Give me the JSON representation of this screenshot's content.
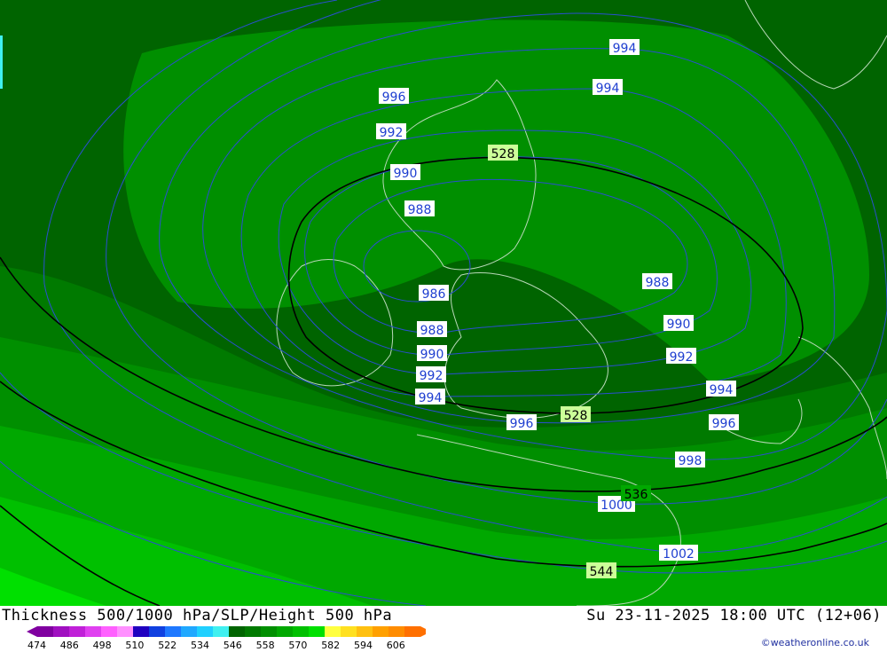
{
  "header": {
    "title": "Thickness 500/1000 hPa/SLP/Height 500 hPa",
    "datetime": "Su 23-11-2025 18:00 UTC (12+06)"
  },
  "credit": "©weatheronline.co.uk",
  "legend": {
    "labels": [
      "474",
      "486",
      "498",
      "510",
      "522",
      "534",
      "546",
      "558",
      "570",
      "582",
      "594",
      "606"
    ],
    "colors": [
      "#8000a0",
      "#a010c0",
      "#c020d8",
      "#e040f0",
      "#ff60ff",
      "#ff90ff",
      "#2000c0",
      "#1040e0",
      "#1e78ff",
      "#20a8ff",
      "#20d0ff",
      "#40f0f0",
      "#006400",
      "#007a00",
      "#008f00",
      "#00a800",
      "#00c000",
      "#00e000",
      "#ffff40",
      "#ffe020",
      "#ffc010",
      "#ffa000",
      "#ff8c00",
      "#ff7000"
    ]
  },
  "map": {
    "colors": {
      "band_dark": "#006400",
      "band_mid": "#007a00",
      "band_main": "#008f00",
      "band_light": "#00a800",
      "band_lighter": "#00c000",
      "band_lightest": "#00e000",
      "isobar": "#2a4fd0",
      "coastline": "#b8d8b8",
      "contour_500": "#000000"
    },
    "isobar_labels": [
      "994",
      "996",
      "994",
      "992",
      "990",
      "988",
      "986",
      "988",
      "990",
      "992",
      "994",
      "988",
      "990",
      "992",
      "994",
      "996",
      "996",
      "998",
      "1000",
      "1002"
    ],
    "thickness_labels": [
      "528",
      "528",
      "536",
      "544"
    ]
  }
}
